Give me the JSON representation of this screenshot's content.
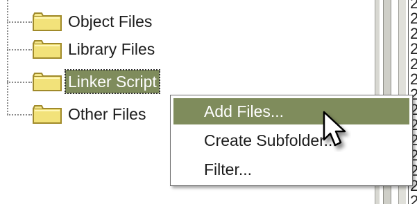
{
  "tree": {
    "items": [
      {
        "label": "Object Files",
        "selected": false,
        "icon": "folder-icon"
      },
      {
        "label": "Library Files",
        "selected": false,
        "icon": "folder-icon"
      },
      {
        "label": "Linker Script",
        "selected": true,
        "icon": "folder-icon"
      },
      {
        "label": "Other Files",
        "selected": false,
        "icon": "folder-icon"
      }
    ]
  },
  "right_column": {
    "digits": [
      "2",
      "2",
      "2",
      "2",
      "2",
      "2",
      "2",
      "2",
      "2",
      "2",
      "2",
      "2",
      "2",
      "2"
    ]
  },
  "context_menu": {
    "items": [
      {
        "label": "Add Files...",
        "highlighted": true
      },
      {
        "label": "Create Subfolder...",
        "highlighted": false
      },
      {
        "label": "Filter...",
        "highlighted": false
      }
    ]
  },
  "cursor": {
    "icon": "arrow-cursor-icon"
  },
  "colors": {
    "selection": "#7f8c5c",
    "folder_fill": "#f2e27a",
    "folder_outline": "#a08a2a",
    "text": "#1b1b1b"
  }
}
